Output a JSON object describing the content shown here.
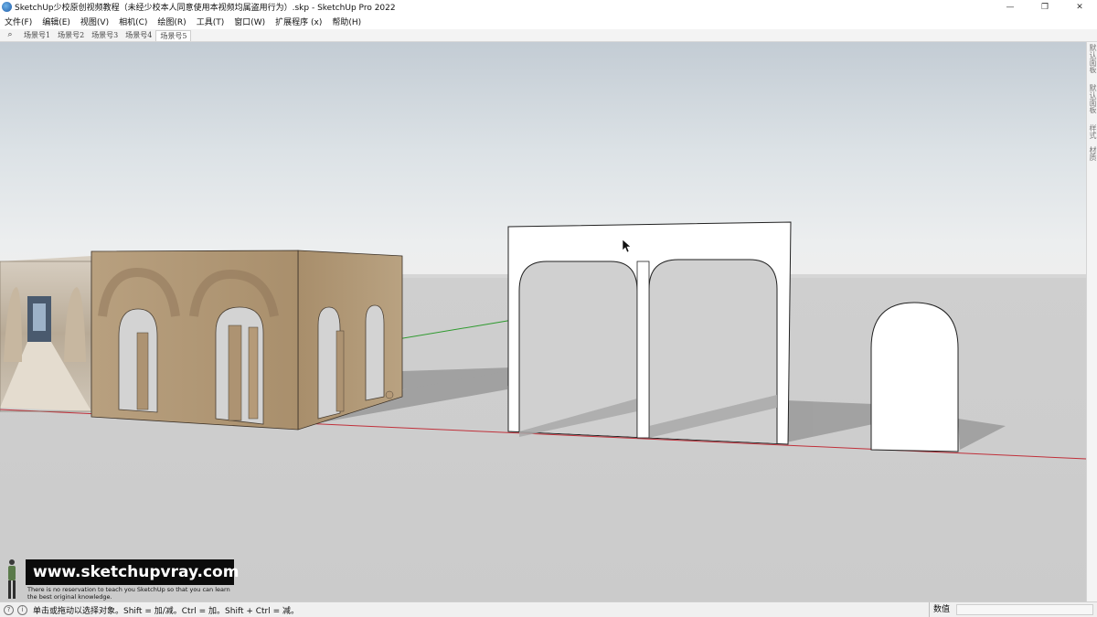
{
  "window": {
    "title": "SketchUp少校原创视频教程（未经少校本人同意使用本视频均属盗用行为）.skp - SketchUp Pro 2022",
    "minimize_glyph": "—",
    "maximize_glyph": "❐",
    "close_glyph": "✕"
  },
  "menu": {
    "items": [
      "文件(F)",
      "编辑(E)",
      "视图(V)",
      "相机(C)",
      "绘图(R)",
      "工具(T)",
      "窗口(W)",
      "扩展程序 (x)",
      "帮助(H)"
    ]
  },
  "scenes": {
    "search_glyph": "⌕",
    "tabs": [
      "场景号1",
      "场景号2",
      "场景号3",
      "场景号4",
      "场景号5"
    ],
    "active_index": 4
  },
  "right_tray": {
    "labels": [
      "默认面板",
      "默认面板",
      "样式",
      "材质"
    ]
  },
  "watermark": {
    "url": "www.sketchupvray.com",
    "tagline": "There is no reservation to teach you SketchUp so that you can learn the best original knowledge."
  },
  "status": {
    "icon_1": "?",
    "icon_2": "i",
    "message": "单击或拖动以选择对象。Shift = 加/减。Ctrl = 加。Shift + Ctrl = 减。",
    "measurements_label": "数值",
    "measurements_value": ""
  },
  "colors": {
    "sky_top": "#c3ccd4",
    "ground": "#cbcbcb",
    "arch_material": "#b59a78",
    "red_axis": "#c0303a",
    "green_axis": "#2e9a2e"
  },
  "icons": {
    "app": "sketchup-logo-icon",
    "search": "search-icon",
    "status_help": "help-icon",
    "status_info": "info-icon"
  }
}
